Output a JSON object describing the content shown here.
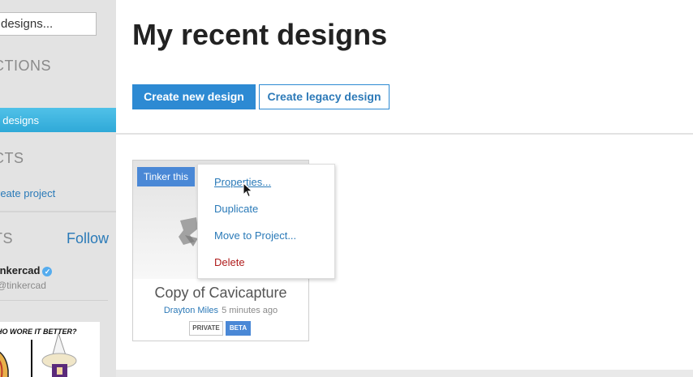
{
  "sidebar": {
    "search_value": "designs...",
    "collections_heading": "CTIONS",
    "active_item": "t designs",
    "projects_heading": "CTS",
    "create_project": "reate project",
    "tweets_heading": "TS",
    "follow_label": "Follow",
    "tweet_name": "inkercad",
    "tweet_handle": "@tinkercad",
    "tweet_image_text": "HO WORE IT BETTER?"
  },
  "main": {
    "title": "My recent designs",
    "create_new_label": "Create new design",
    "create_legacy_label": "Create legacy design"
  },
  "card": {
    "tinker_label": "Tinker this",
    "title": "Copy of Cavicapture",
    "author": "Drayton Miles",
    "time": "5 minutes ago",
    "badge_private": "PRIVATE",
    "badge_beta": "BETA"
  },
  "menu": {
    "items": [
      "Properties...",
      "Duplicate",
      "Move to Project...",
      "Delete"
    ]
  },
  "colors": {
    "accent": "#2d8ad3",
    "sidebar_active": "#3fb3e0",
    "delete": "#b01c1c"
  }
}
